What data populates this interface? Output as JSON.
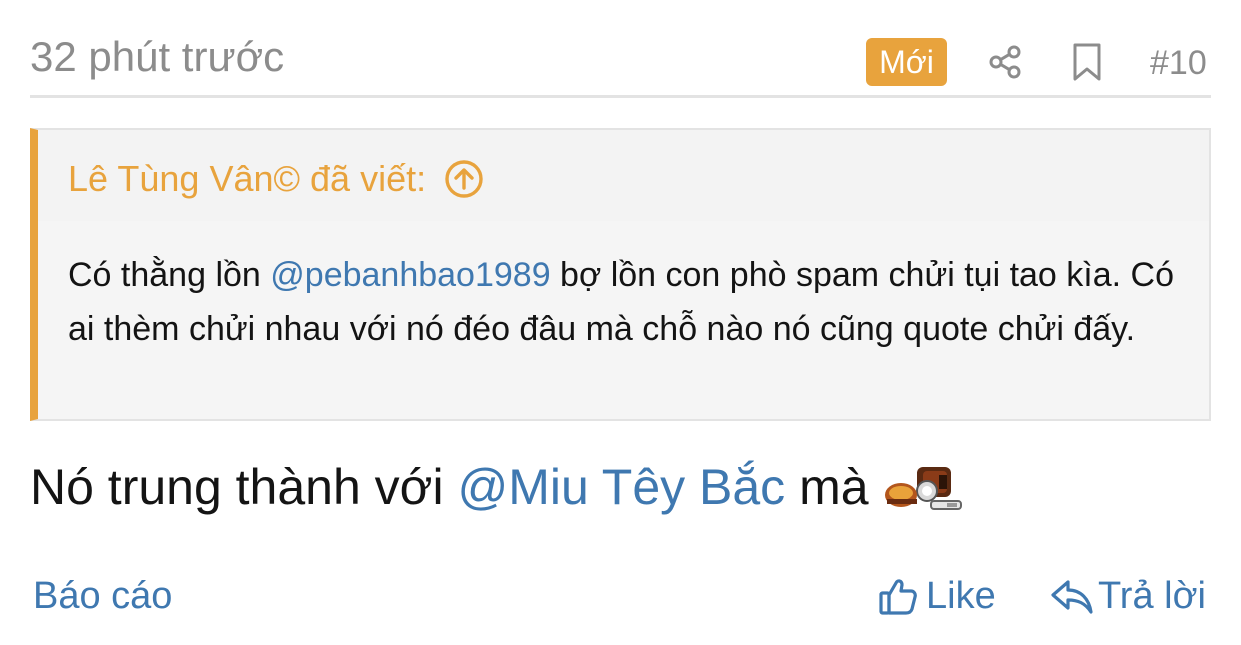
{
  "header": {
    "timestamp": "32 phút trước",
    "badge": "Mới",
    "share_icon": "share-icon",
    "bookmark_icon": "bookmark-icon",
    "post_number": "#10"
  },
  "quote": {
    "author": "Lê Tùng Vân© đã viết:",
    "jump_icon": "arrow-up-circle-icon",
    "text_before": "Có thằng lồn ",
    "mention": "@pebanhbao1989",
    "text_after": " bợ lồn con phò spam chửi tụi tao kìa. Có ai thèm chửi nhau với nó đéo đâu mà chỗ nào nó cũng quote chửi đấy."
  },
  "post": {
    "text_before": "Nó trung thành với ",
    "mention": "@Miu Têy Bắc",
    "text_after": " mà",
    "emoji": "pixel-emoji-icon"
  },
  "footer": {
    "report": "Báo cáo",
    "like": "Like",
    "like_icon": "thumbs-up-icon",
    "reply": "Trả lời",
    "reply_icon": "reply-arrow-icon"
  },
  "colors": {
    "accent": "#e8a33d",
    "link": "#3f78b0",
    "muted": "#8c8c8c",
    "border": "#e3e3e3",
    "quote_bg": "#f5f5f5"
  }
}
